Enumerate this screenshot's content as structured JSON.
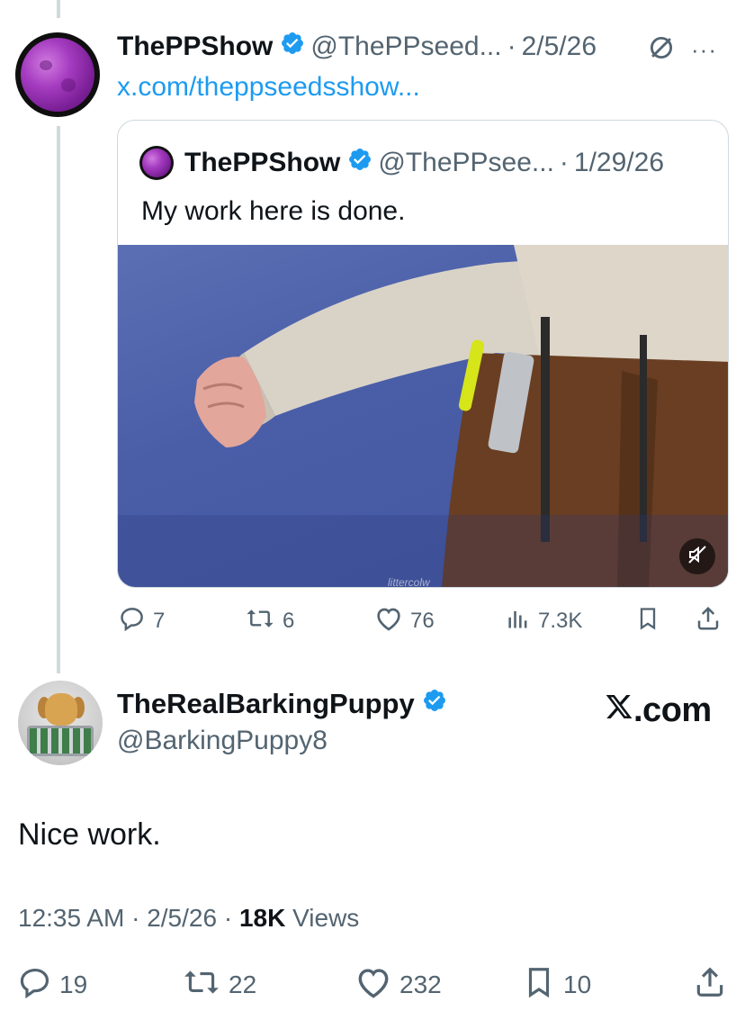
{
  "parent_tweet": {
    "display_name": "ThePPShow",
    "handle": "@ThePPseed...",
    "separator": "·",
    "date": "2/5/26",
    "link": "x.com/theppseedsshow...",
    "more_label": "···"
  },
  "quoted_tweet": {
    "display_name": "ThePPShow",
    "handle": "@ThePPsee...",
    "separator": "·",
    "date": "1/29/26",
    "text": "My work here is done.",
    "media_watermark": "littercolw"
  },
  "quote_actions": {
    "replies": "7",
    "reposts": "6",
    "likes": "76",
    "views": "7.3K"
  },
  "reply_tweet": {
    "display_name": "TheRealBarkingPuppy",
    "handle": "@BarkingPuppy8",
    "badge_text": ".com",
    "text": "Nice work.",
    "time": "12:35 AM",
    "separator": "·",
    "date": "2/5/26",
    "views_count": "18K",
    "views_label": "Views"
  },
  "bottom_actions": {
    "replies": "19",
    "reposts": "22",
    "likes": "232",
    "bookmarks": "10"
  },
  "colors": {
    "verified": "#1d9bf0",
    "link": "#1d9bf0",
    "muted": "#536471",
    "divider": "#cfd9de"
  },
  "icons": [
    "verified-badge-icon",
    "grok-icon",
    "more-icon",
    "mute-icon",
    "reply-icon",
    "repost-icon",
    "like-icon",
    "views-icon",
    "bookmark-icon",
    "share-icon",
    "x-logo-icon"
  ]
}
